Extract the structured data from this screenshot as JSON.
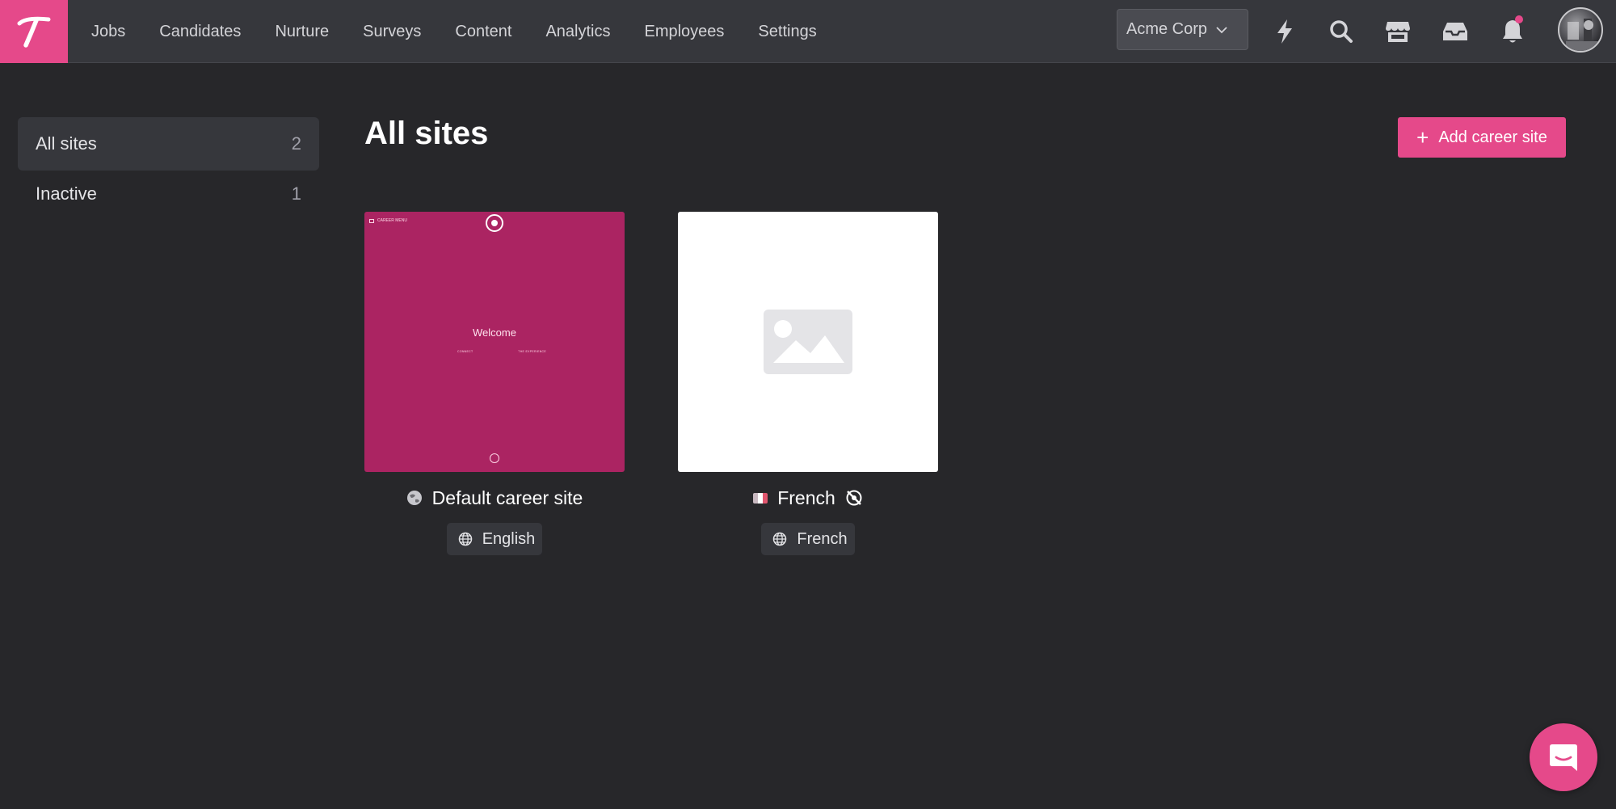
{
  "nav": {
    "items": [
      {
        "label": "Jobs"
      },
      {
        "label": "Candidates"
      },
      {
        "label": "Nurture"
      },
      {
        "label": "Surveys"
      },
      {
        "label": "Content"
      },
      {
        "label": "Analytics"
      },
      {
        "label": "Employees"
      },
      {
        "label": "Settings"
      }
    ],
    "org_label": "Acme Corp",
    "icons": [
      "bolt-icon",
      "search-icon",
      "store-icon",
      "inbox-icon",
      "bell-icon"
    ],
    "has_notification": true
  },
  "sidebar": {
    "items": [
      {
        "label": "All sites",
        "count": "2",
        "active": true
      },
      {
        "label": "Inactive",
        "count": "1",
        "active": false
      }
    ]
  },
  "main": {
    "title": "All sites",
    "add_button_label": "Add career site",
    "cards": [
      {
        "name": "Default career site",
        "language": "English",
        "preview": {
          "menu_text": "CAREER MENU",
          "welcome": "Welcome",
          "link_left": "CONNECT",
          "link_right": "THE EXPERIENCE"
        }
      },
      {
        "name": "French",
        "language": "French",
        "inactive": true
      }
    ]
  },
  "colors": {
    "brand": "#e5498a",
    "preview_bg": "#ab2462",
    "background": "#27272a",
    "topbar": "#36373c"
  }
}
